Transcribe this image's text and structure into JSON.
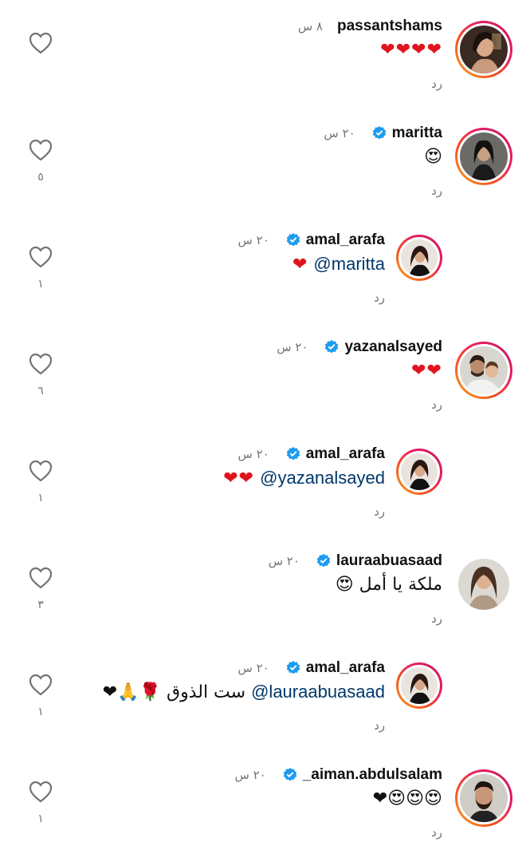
{
  "comments": [
    {
      "username": "passantshams",
      "verified": false,
      "time": "٨ س",
      "text": "❤❤❤❤",
      "reply_label": "رد",
      "likes": "",
      "avatar": "woman-dark-hair-icon"
    },
    {
      "username": "maritta",
      "verified": true,
      "time": "٢٠ س",
      "text": "😍",
      "reply_label": "رد",
      "likes": "٥",
      "avatar": "woman-black-hair-icon"
    },
    {
      "username": "amal_arafa",
      "verified": true,
      "time": "٢٠ س",
      "mention": "@maritta",
      "text": "❤",
      "reply_label": "رد",
      "likes": "١",
      "avatar": "woman-brown-hair-icon"
    },
    {
      "username": "yazanalsayed",
      "verified": true,
      "time": "٢٠ س",
      "text": "❤❤",
      "reply_label": "رد",
      "likes": "٦",
      "avatar": "man-with-child-icon"
    },
    {
      "username": "amal_arafa",
      "verified": true,
      "time": "٢٠ س",
      "mention": "@yazanalsayed",
      "text": "❤❤",
      "reply_label": "رد",
      "likes": "١",
      "avatar": "woman-brown-hair-icon"
    },
    {
      "username": "lauraabuasaad",
      "verified": true,
      "time": "٢٠ س",
      "text": "ملكة يا أمل 😍",
      "reply_label": "رد",
      "likes": "٣",
      "avatar": "woman-long-hair-icon"
    },
    {
      "username": "amal_arafa",
      "verified": true,
      "time": "٢٠ س",
      "mention": "@lauraabuasaad",
      "text": "ست الذوق 🌹🙏❤",
      "reply_label": "رد",
      "likes": "١",
      "avatar": "woman-brown-hair-icon"
    },
    {
      "username": "_aiman.abdulsalam",
      "verified": true,
      "time": "٢٠ س",
      "text": "😍😍😍❤",
      "reply_label": "رد",
      "likes": "١",
      "avatar": "man-beard-icon"
    }
  ],
  "colors": {
    "verified": "#1d9bf0",
    "heart": "#e0141e",
    "mention": "#00376b",
    "meta": "#737373"
  }
}
